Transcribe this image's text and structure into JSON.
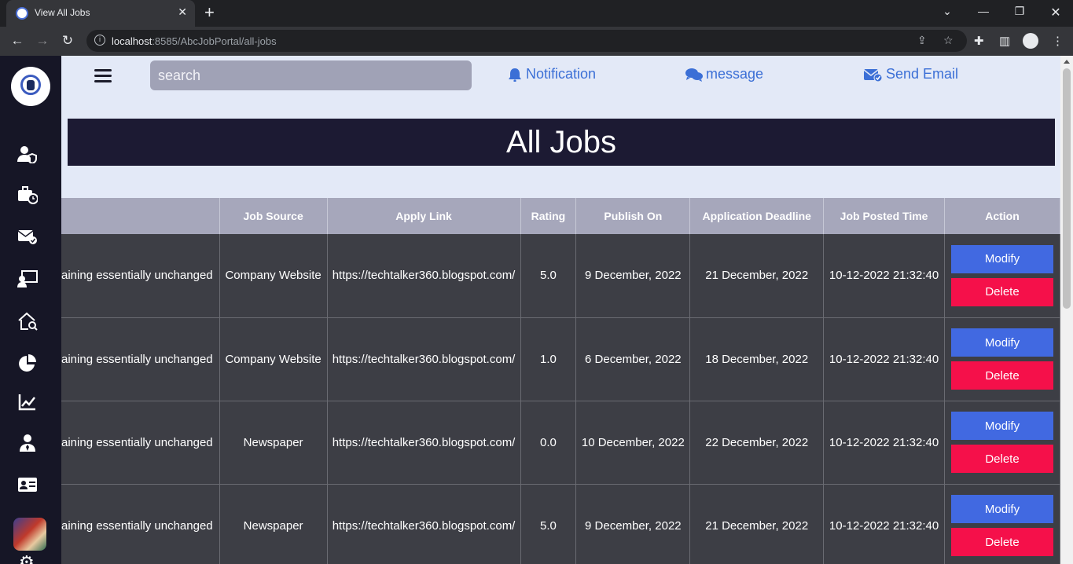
{
  "browser": {
    "tab_title": "View All Jobs",
    "url_host": "localhost",
    "url_rest": ":8585/AbcJobPortal/all-jobs"
  },
  "header": {
    "search_placeholder": "search",
    "notification_label": "Notification",
    "message_label": "message",
    "send_email_label": "Send Email"
  },
  "banner": {
    "title": "All Jobs"
  },
  "table": {
    "headers": [
      "",
      "Job Source",
      "Apply Link",
      "Rating",
      "Publish On",
      "Application Deadline",
      "Job Posted Time",
      "Action"
    ],
    "rows": [
      {
        "desc": "aining essentially unchanged",
        "source": "Company Website",
        "link": "https://techtalker360.blogspot.com/",
        "rating": "5.0",
        "publish": "9 December, 2022",
        "deadline": "21 December, 2022",
        "posted": "10-12-2022 21:32:40"
      },
      {
        "desc": "aining essentially unchanged",
        "source": "Company Website",
        "link": "https://techtalker360.blogspot.com/",
        "rating": "1.0",
        "publish": "6 December, 2022",
        "deadline": "18 December, 2022",
        "posted": "10-12-2022 21:32:40"
      },
      {
        "desc": "aining essentially unchanged",
        "source": "Newspaper",
        "link": "https://techtalker360.blogspot.com/",
        "rating": "0.0",
        "publish": "10 December, 2022",
        "deadline": "22 December, 2022",
        "posted": "10-12-2022 21:32:40"
      },
      {
        "desc": "aining essentially unchanged",
        "source": "Newspaper",
        "link": "https://techtalker360.blogspot.com/",
        "rating": "5.0",
        "publish": "9 December, 2022",
        "deadline": "21 December, 2022",
        "posted": "10-12-2022 21:32:40"
      }
    ],
    "modify_label": "Modify",
    "delete_label": "Delete"
  },
  "sidebar": {
    "icons": [
      "user-shield-icon",
      "briefcase-clock-icon",
      "envelope-check-icon",
      "chalkboard-user-icon",
      "house-search-icon",
      "pie-chart-icon",
      "line-chart-icon",
      "user-tie-icon",
      "id-card-icon",
      "gear-icon"
    ]
  },
  "colors": {
    "sidebar": "#161626",
    "banner": "#1c1a33",
    "modify": "#4169e1",
    "delete": "#f5104a",
    "link": "#3b6fd6"
  }
}
